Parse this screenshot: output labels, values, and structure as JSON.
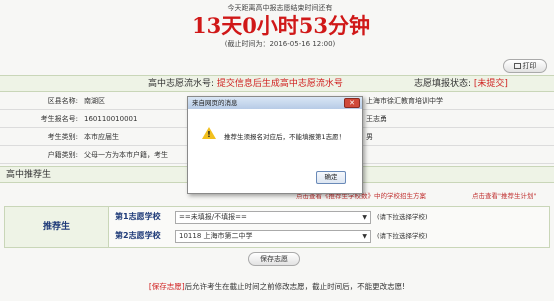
{
  "header": {
    "top_note": "今天距离高中报志愿结束时间还有",
    "countdown": "13天0小时53分钟",
    "deadline": "(截止时间为：2016-05-16 12:00)"
  },
  "toolbar": {
    "print_label": "打印"
  },
  "status_bar": {
    "flow_label": "高中志愿流水号:",
    "flow_value": "提交信息后生成高中志愿流水号",
    "status_label": "志愿填报状态:",
    "status_value": "[未提交]"
  },
  "info": {
    "rows": [
      {
        "key": "区县名称:",
        "value": "南湖区",
        "right": "上海市徐汇教育培训中学"
      },
      {
        "key": "考生报名号:",
        "value": "160110010001",
        "right": "王志勇"
      },
      {
        "key": "考生类别:",
        "value": "本市应届生",
        "right": "男"
      },
      {
        "key": "户籍类别:",
        "value": "父母一方为本市户籍，考生",
        "right": ""
      }
    ]
  },
  "section": {
    "title": "高中推荐生"
  },
  "links": {
    "link1": "点击查看《推荐生学校数》中的学校招生方案",
    "link2": "点击查看\"推荐生计划\""
  },
  "recommend": {
    "label": "推荐生",
    "choice1_label": "第1志愿学校",
    "choice1_value": "==未填报/不填报==",
    "choice1_hint": "(请下拉选择学校)",
    "choice2_label": "第2志愿学校",
    "choice2_value": "10118 上海市第二中学",
    "choice2_hint": "(请下拉选择学校)"
  },
  "save_label": "保存志愿",
  "footer": {
    "tag": "[保存志愿]",
    "text": "后允许考生在截止时间之前修改志愿，截止时间后，不能更改志愿!"
  },
  "dialog": {
    "title": "来自网页的消息",
    "close_label": "✕",
    "message": "推荐生须报名对应后，不能填报第1志愿！",
    "ok_label": "确定"
  }
}
